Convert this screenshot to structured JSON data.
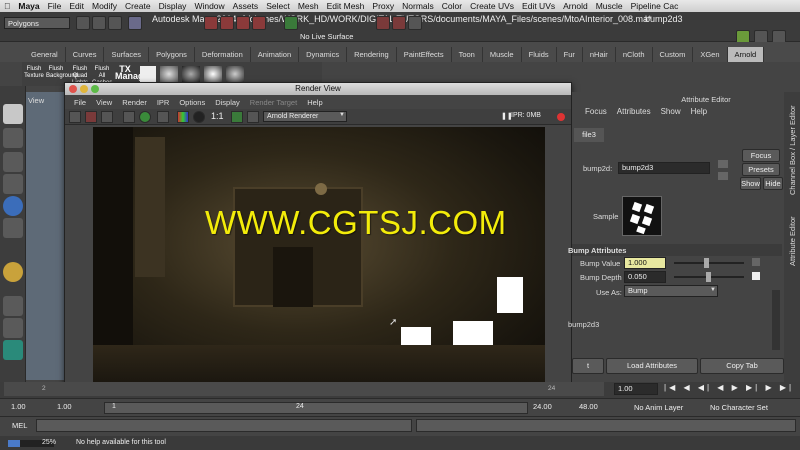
{
  "mac_menu": {
    "app": "Maya",
    "items": [
      "File",
      "Edit",
      "Modify",
      "Create",
      "Display",
      "Window",
      "Assets",
      "Select",
      "Mesh",
      "Edit Mesh",
      "Proxy",
      "Normals",
      "Color",
      "Create UVs",
      "Edit UVs",
      "Arnold",
      "Muscle",
      "Pipeline Cac"
    ]
  },
  "window": {
    "mode": "Polygons",
    "title": "Autodesk Maya 2014: /Volumes/WORK_HD/WORK/DIGITAL TUTORS/documents/MAYA_Files/scenes/MtoAInterior_008.ma*",
    "node": "bump2d3",
    "no_live_surface": "No Live Surface"
  },
  "shelf_tabs": [
    "General",
    "Curves",
    "Surfaces",
    "Polygons",
    "Deformation",
    "Animation",
    "Dynamics",
    "Rendering",
    "PaintEffects",
    "Toon",
    "Muscle",
    "Fluids",
    "Fur",
    "nHair",
    "nCloth",
    "Custom",
    "XGen",
    "Arnold"
  ],
  "shelf_icons": [
    "Flush Texture",
    "Flush Background",
    "Flush Quad Lights",
    "Flush All Caches",
    "TX Manager"
  ],
  "viewport": {
    "menu": "View"
  },
  "render_view": {
    "title": "Render View",
    "menus": [
      "File",
      "View",
      "Render",
      "IPR",
      "Options",
      "Display"
    ],
    "menu_disabled": "Render Target",
    "menu_help": "Help",
    "ratio": "1:1",
    "renderer": "Arnold Renderer",
    "ipr_status": "IPR: 0MB"
  },
  "attribute_editor": {
    "title": "Attribute Editor",
    "menus": [
      "Focus",
      "Attributes",
      "Show",
      "Help"
    ],
    "tab": "file3",
    "node_label": "bump2d:",
    "node_value": "bump2d3",
    "focus_btn": "Focus",
    "presets_btn": "Presets",
    "show_btn": "Show",
    "hide_btn": "Hide",
    "sample_label": "Sample",
    "section": "Bump Attributes",
    "bump_value_label": "Bump Value",
    "bump_value": "1.000",
    "bump_depth_label": "Bump Depth",
    "bump_depth": "0.050",
    "use_as_label": "Use As:",
    "use_as": "Bump",
    "notes": "bump2d3",
    "load_attributes": "Load Attributes",
    "copy_tab": "Copy Tab",
    "select_partial": "t",
    "side_tab_1": "Channel Box / Layer Editor",
    "side_tab_2": "Attribute Editor"
  },
  "timeslider": {
    "tick_2": "2",
    "tick_24": "24",
    "current": "1.00"
  },
  "range": {
    "start": "1.00",
    "start2": "1.00",
    "slider_start": "1",
    "slider_end": "24",
    "end": "24.00",
    "end2": "48.00",
    "anim_layer": "No Anim Layer",
    "char_set": "No Character Set"
  },
  "mel": {
    "label": "MEL"
  },
  "help": {
    "progress": "25%",
    "progress_value": 0.25,
    "text": "No help available for this tool"
  },
  "watermark": "WWW.CGTSJ.COM"
}
